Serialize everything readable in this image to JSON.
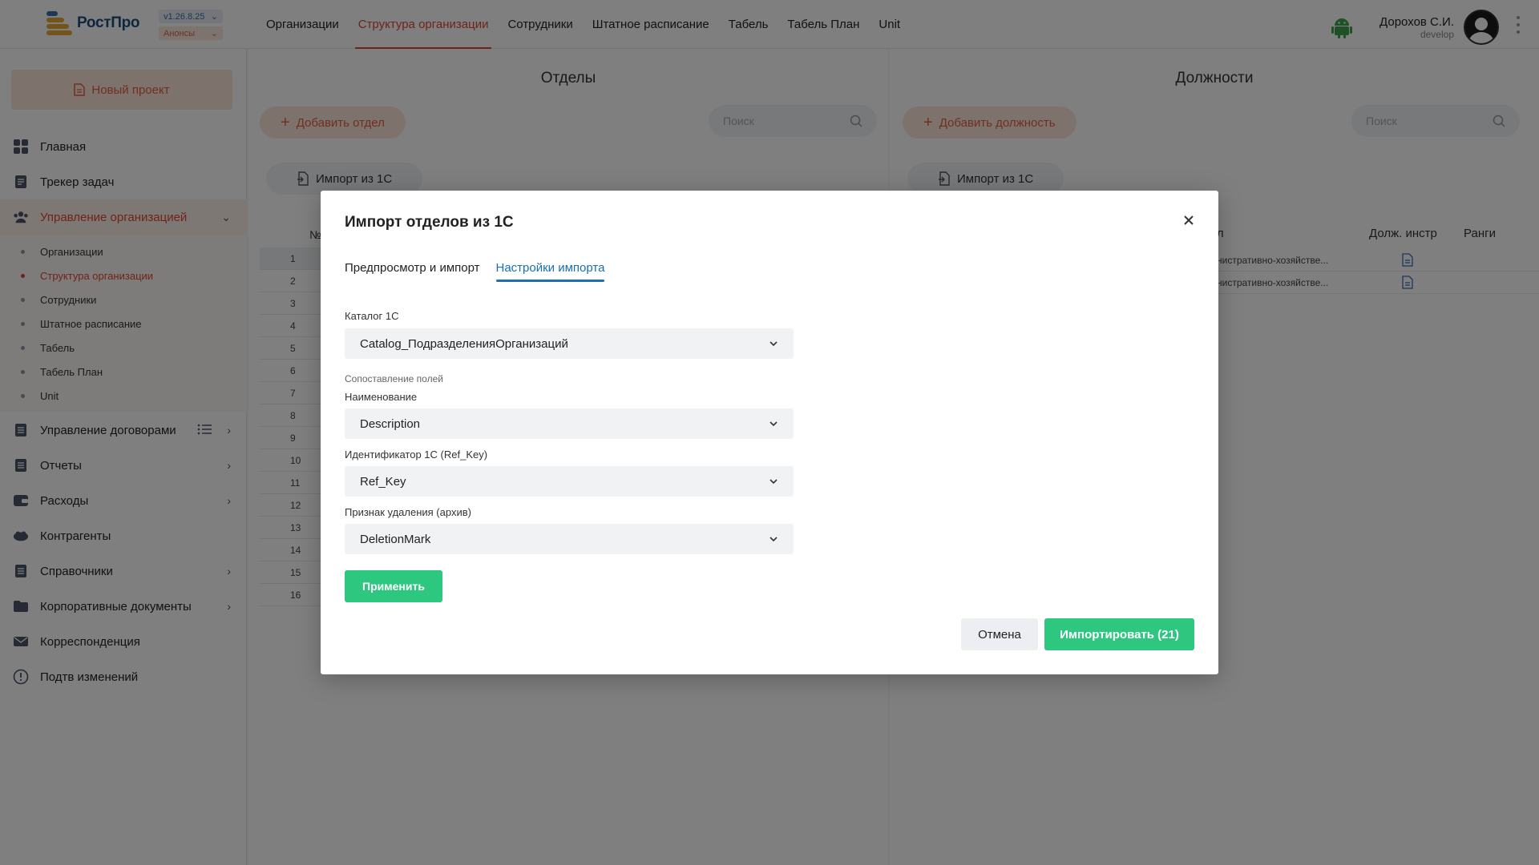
{
  "app": {
    "logo_text": "РостПро",
    "version": "v1.26.8.25",
    "announcements": "Анонсы"
  },
  "topnav": {
    "items": [
      "Организации",
      "Структура организации",
      "Сотрудники",
      "Штатное расписание",
      "Табель",
      "Табель План",
      "Unit"
    ],
    "active_index": 1
  },
  "user": {
    "name": "Дорохов С.И.",
    "role": "develop"
  },
  "sidebar": {
    "new_project": "Новый проект",
    "items": [
      {
        "label": "Главная",
        "icon": "dashboard-icon"
      },
      {
        "label": "Трекер задач",
        "icon": "tasks-icon"
      },
      {
        "label": "Управление организацией",
        "icon": "people-icon",
        "expanded": true
      },
      {
        "label": "Управление договорами",
        "icon": "contract-icon"
      },
      {
        "label": "Отчеты",
        "icon": "report-icon"
      },
      {
        "label": "Расходы",
        "icon": "wallet-icon"
      },
      {
        "label": "Контрагенты",
        "icon": "partners-icon"
      },
      {
        "label": "Справочники",
        "icon": "book-icon"
      },
      {
        "label": "Корпоративные документы",
        "icon": "folder-icon"
      },
      {
        "label": "Корреспонденция",
        "icon": "mail-icon"
      },
      {
        "label": "Подтв изменений",
        "icon": "alert-icon"
      }
    ],
    "subitems": [
      "Организации",
      "Структура организации",
      "Сотрудники",
      "Штатное расписание",
      "Табель",
      "Табель План",
      "Unit"
    ],
    "active_subitem": 1
  },
  "left_pane": {
    "title": "Отделы",
    "add_button": "Добавить отдел",
    "search_placeholder": "Поиск",
    "import_button": "Импорт из 1С",
    "column_number": "№",
    "row_numbers": [
      "1",
      "2",
      "3",
      "4",
      "5",
      "6",
      "7",
      "8",
      "9",
      "10",
      "11",
      "12",
      "13",
      "14",
      "15",
      "16"
    ]
  },
  "right_pane": {
    "title": "Должности",
    "add_button": "Добавить должность",
    "search_placeholder": "Поиск",
    "import_button": "Импорт из 1С",
    "col_department": "ел",
    "col_instructions": "Долж. инстр",
    "col_ranks": "Ранги",
    "rows": [
      "нистративно-хозяйстве...",
      "нистративно-хозяйстве..."
    ]
  },
  "modal": {
    "title": "Импорт отделов из 1С",
    "tabs": [
      "Предпросмотр и импорт",
      "Настройки импорта"
    ],
    "active_tab": 1,
    "catalog_label": "Каталог 1С",
    "catalog_value": "Catalog_ПодразделенияОрганизаций",
    "mapping_label": "Сопоставление полей",
    "name_label": "Наименование",
    "name_value": "Description",
    "id_label": "Идентификатор 1С (Ref_Key)",
    "id_value": "Ref_Key",
    "deletion_label": "Признак удаления (архив)",
    "deletion_value": "DeletionMark",
    "apply_button": "Применить",
    "cancel_button": "Отмена",
    "import_button": "Импортировать (21)"
  },
  "colors": {
    "accent": "#e0472d",
    "primary_green": "#2ec77f",
    "tab_blue": "#1a6fb5"
  }
}
